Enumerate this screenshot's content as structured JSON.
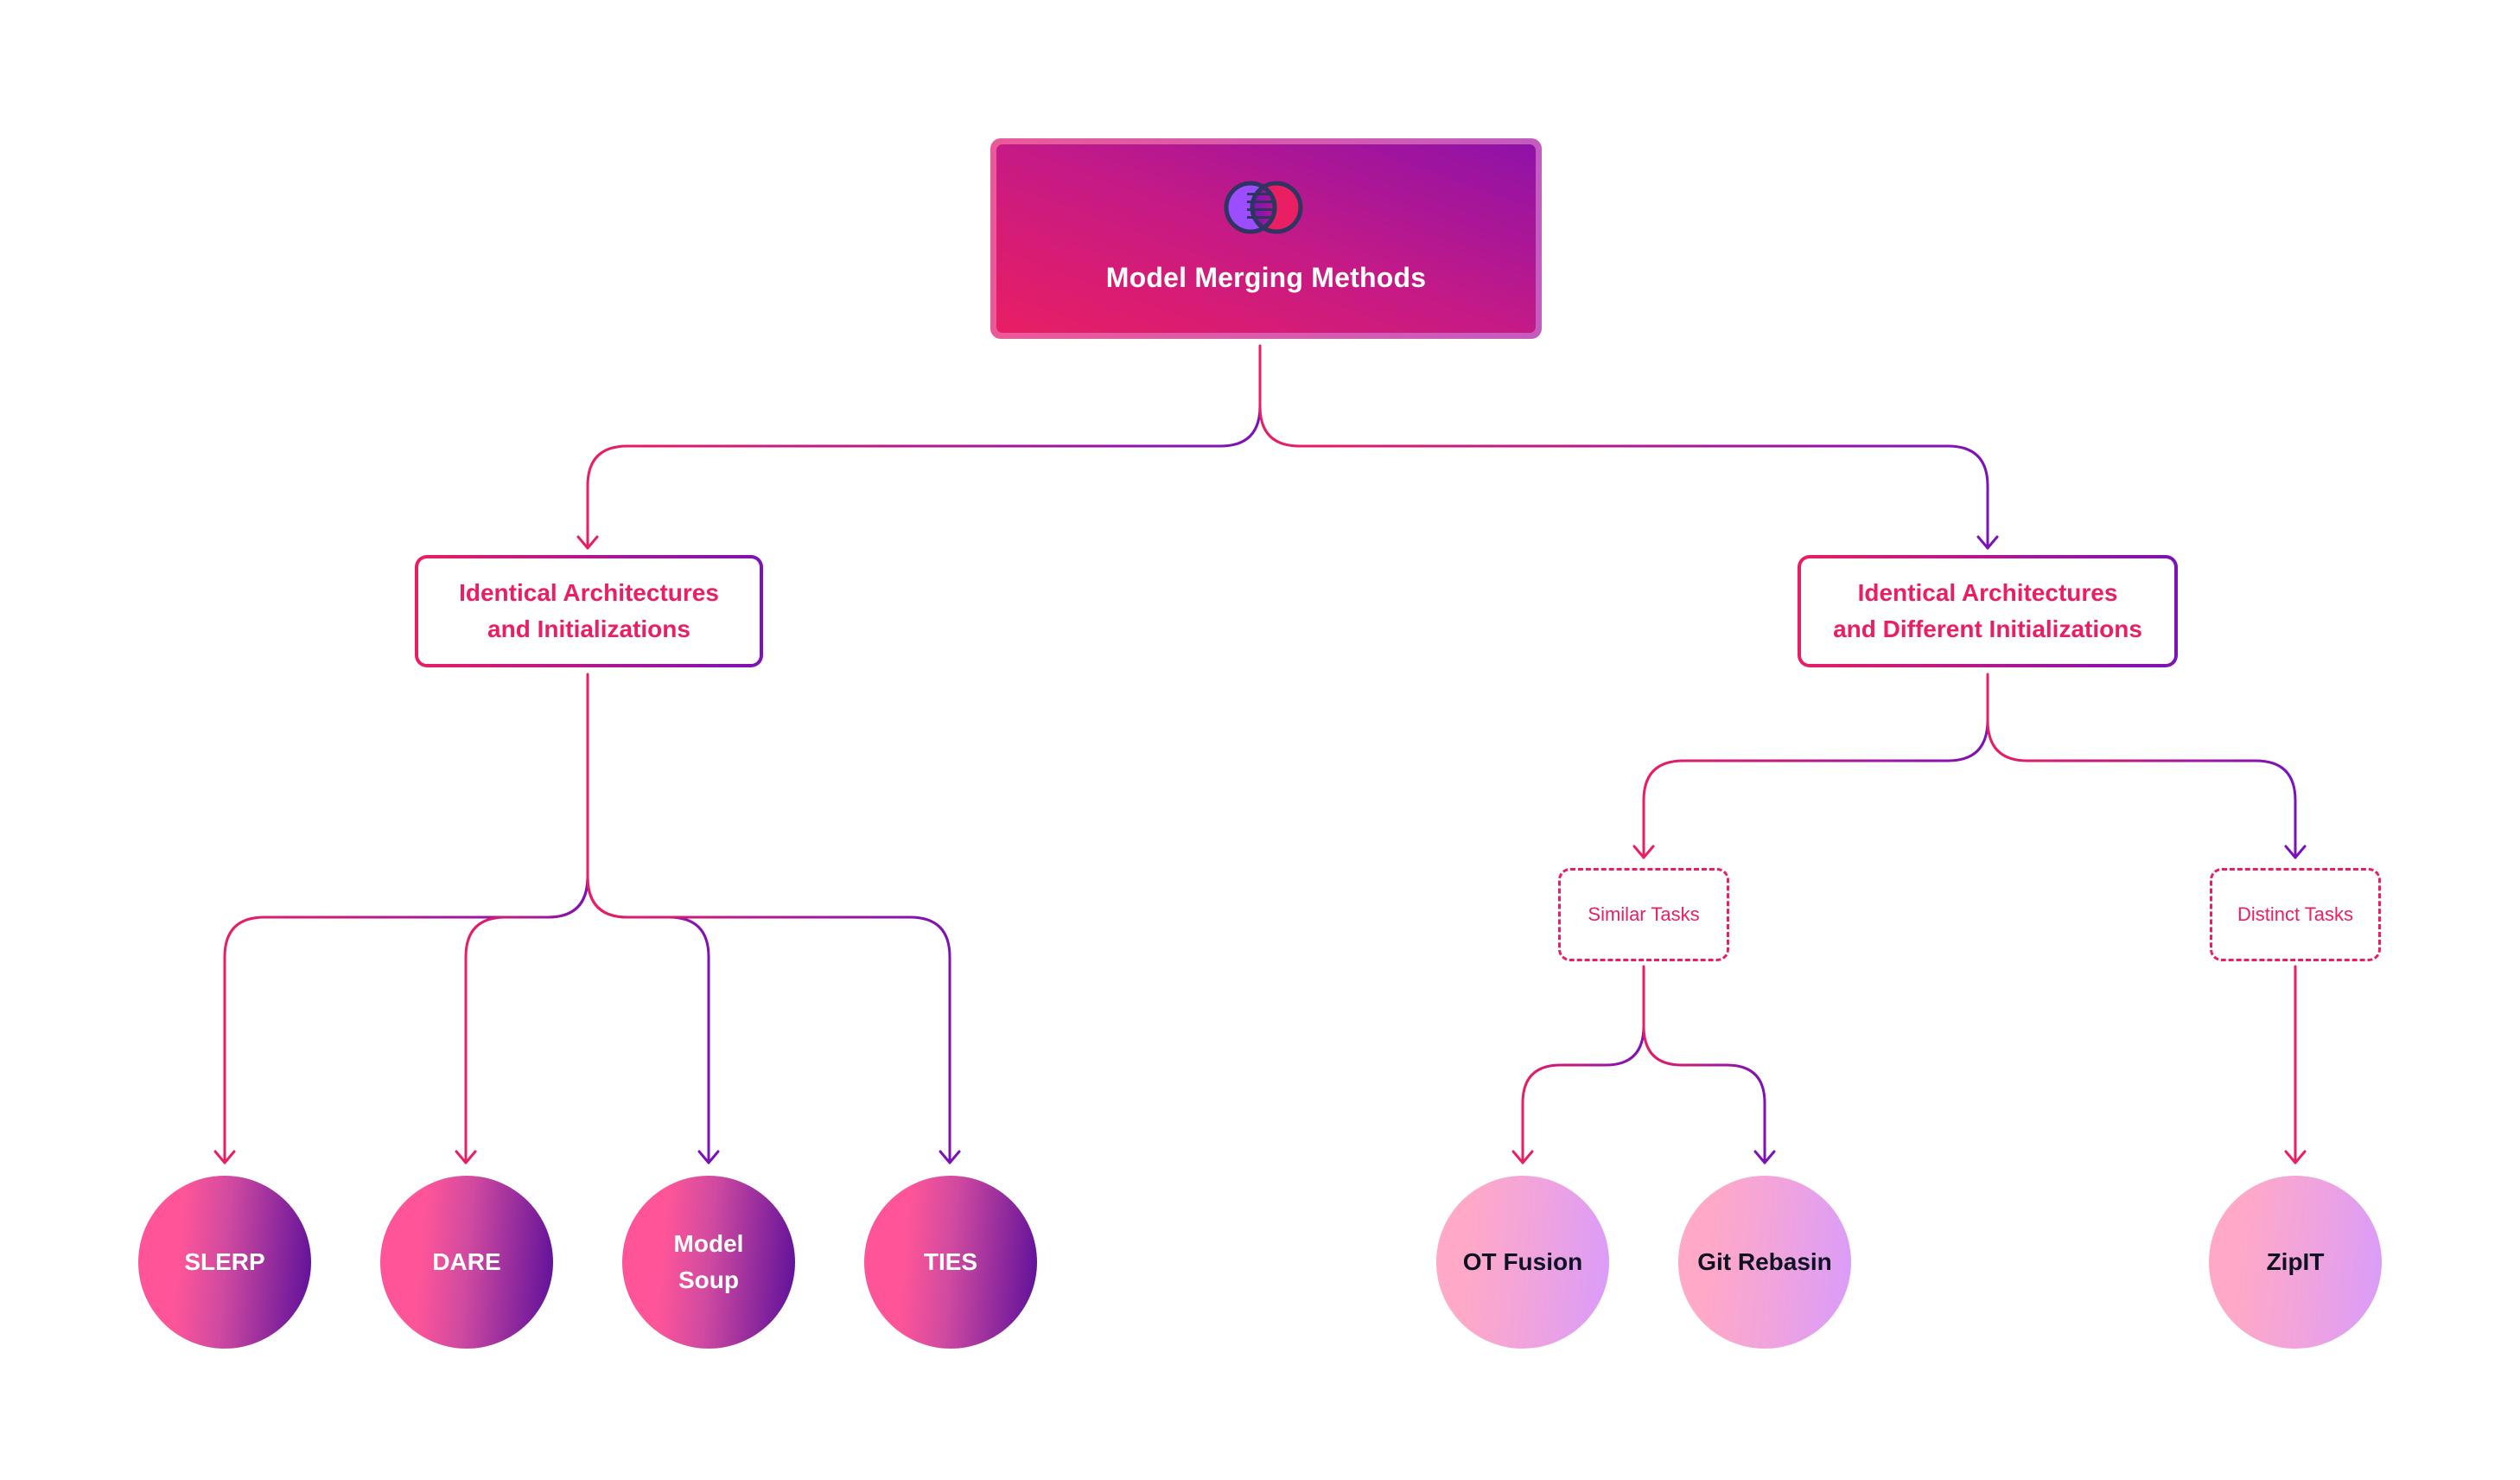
{
  "diagram": {
    "title": "Model Merging Methods",
    "root_icon": "venn-merge-icon",
    "colors": {
      "accent_pink": "#e91e63",
      "accent_purple": "#7b12b8",
      "icon_left": "#9b4dff",
      "icon_right": "#e91e63",
      "icon_stroke": "#2e3560",
      "leaf_text_dark": "#0f1222"
    },
    "categories": [
      {
        "id": "same-init",
        "lines": [
          "Identical Architectures",
          "and Initializations"
        ],
        "children": [
          "slerp",
          "dare",
          "model-soup",
          "ties"
        ]
      },
      {
        "id": "diff-init",
        "lines": [
          "Identical Architectures",
          "and Different Initializations"
        ],
        "children": [
          "similar-tasks",
          "distinct-tasks"
        ]
      }
    ],
    "tasks": [
      {
        "id": "similar-tasks",
        "label": "Similar Tasks",
        "children": [
          "ot-fusion",
          "git-rebasin"
        ]
      },
      {
        "id": "distinct-tasks",
        "label": "Distinct Tasks",
        "children": [
          "zipit"
        ]
      }
    ],
    "methods": [
      {
        "id": "slerp",
        "lines": [
          "SLERP"
        ],
        "style": "dark"
      },
      {
        "id": "dare",
        "lines": [
          "DARE"
        ],
        "style": "dark"
      },
      {
        "id": "model-soup",
        "lines": [
          "Model",
          "Soup"
        ],
        "style": "dark"
      },
      {
        "id": "ties",
        "lines": [
          "TIES"
        ],
        "style": "dark"
      },
      {
        "id": "ot-fusion",
        "lines": [
          "OT Fusion"
        ],
        "style": "light"
      },
      {
        "id": "git-rebasin",
        "lines": [
          "Git Rebasin"
        ],
        "style": "light"
      },
      {
        "id": "zipit",
        "lines": [
          "ZipIT"
        ],
        "style": "light"
      }
    ]
  }
}
